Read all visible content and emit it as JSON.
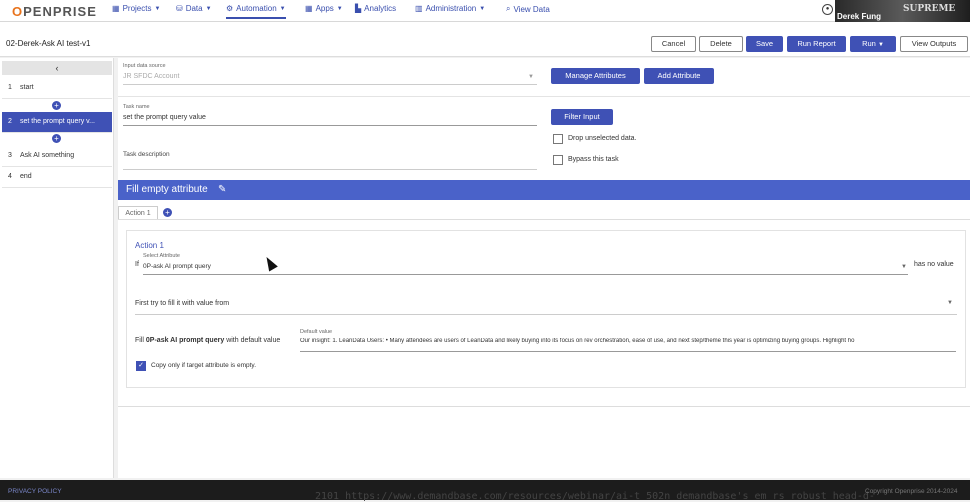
{
  "nav": {
    "logo": "OPENPRISE",
    "items": [
      {
        "label": "Projects",
        "icon": "grid-icon"
      },
      {
        "label": "Data",
        "icon": "database-icon"
      },
      {
        "label": "Automation",
        "icon": "gear-icon"
      },
      {
        "label": "Apps",
        "icon": "grid-icon"
      },
      {
        "label": "Analytics",
        "icon": "chart-icon"
      },
      {
        "label": "Administration",
        "icon": "building-icon"
      },
      {
        "label": "View Data",
        "icon": "search-icon"
      }
    ],
    "user_name": "Derek Fung",
    "webcam_text": "SUPREME"
  },
  "header": {
    "title": "02-Derek-Ask AI test-v1",
    "buttons": [
      "Cancel",
      "Delete",
      "Save",
      "Run Report",
      "Run",
      "View Outputs"
    ]
  },
  "sidebar": {
    "steps": [
      {
        "num": "1",
        "label": "start"
      },
      {
        "num": "2",
        "label": "set the prompt query v..."
      },
      {
        "num": "3",
        "label": "Ask AI something"
      },
      {
        "num": "4",
        "label": "end"
      }
    ]
  },
  "form": {
    "input_source_label": "Input data source",
    "input_source_value": "JR SFDC Account",
    "manage_attributes": "Manage Attributes",
    "add_attribute": "Add Attribute",
    "task_name_label": "Task name",
    "task_name_value": "set the prompt query value",
    "filter_input": "Filter Input",
    "drop_unselected": "Drop unselected data.",
    "bypass_task": "Bypass this task",
    "task_description_label": "Task description"
  },
  "section": {
    "title": "Fill empty attribute",
    "tab": "Action 1"
  },
  "action": {
    "title": "Action 1",
    "if_label": "If",
    "select_attribute_label": "Select Attribute",
    "select_attribute_value": "0P-ask AI prompt query",
    "has_no_value": "has no value",
    "first_try": "First try to fill it with value from",
    "fill_prefix": "Fill",
    "fill_attr": "0P-ask AI prompt query",
    "fill_suffix": "with default value",
    "default_value_label": "Default value",
    "default_value": "Our insight: 1. LeanData Users: • Many attendees are users of LeanData and likely buying into its focus on rev orchestration, ease of use, and next step/theme this year is optimizing buying groups. Highlight ho",
    "copy_only": "Copy only if target attribute is empty."
  },
  "footer": {
    "privacy": "PRIVACY POLICY",
    "copyright": "Copyright Openprise 2014-2024",
    "overlay": "2101   https://www.demandbase.com/resources/webinar/ai-t   502n  demandbase's em rs  robust  head-d-"
  }
}
